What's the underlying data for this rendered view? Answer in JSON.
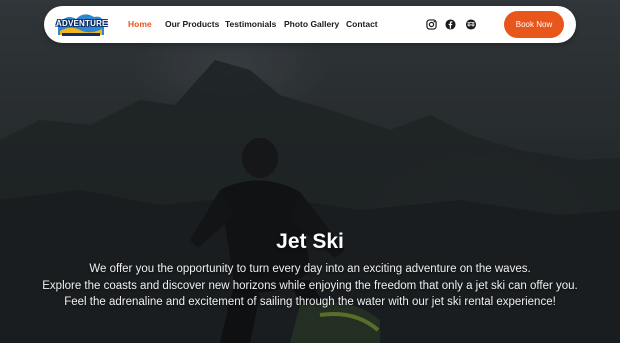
{
  "brand": {
    "logo_text": "ADVENTURE"
  },
  "nav": {
    "items": [
      {
        "label": "Home",
        "active": true
      },
      {
        "label": "Our Products",
        "active": false
      },
      {
        "label": "Testimonials",
        "active": false
      },
      {
        "label": "Photo Gallery",
        "active": false
      },
      {
        "label": "Contact",
        "active": false
      }
    ],
    "social_icons": [
      "instagram-icon",
      "facebook-icon",
      "tripadvisor-icon"
    ],
    "book_button": "Book Now"
  },
  "hero": {
    "title": "Jet Ski",
    "lines": [
      "We offer you the opportunity to turn every day into an exciting adventure on the waves.",
      "Explore the coasts and discover new horizons while enjoying the freedom that only a jet ski can offer you.",
      "Feel the adrenaline and excitement of sailing through the water with our jet ski rental experience!"
    ]
  },
  "colors": {
    "accent": "#e8561c",
    "nav_text": "#1b1b1b",
    "hero_text": "#ffffff"
  }
}
